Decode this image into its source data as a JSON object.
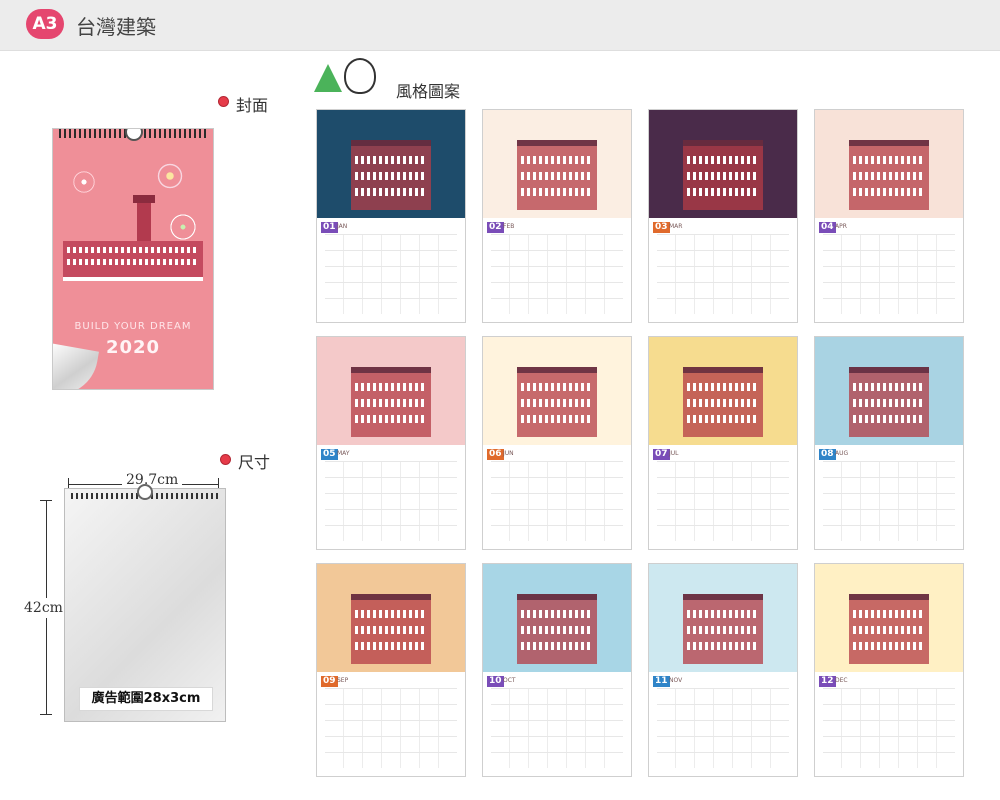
{
  "header": {
    "badge": "A3",
    "title": "台灣建築"
  },
  "cover_section": {
    "label": "封面",
    "build_text": "BUILD YOUR DREAM",
    "year": "2020"
  },
  "size_section": {
    "label": "尺寸",
    "width": "29.7cm",
    "height": "42cm",
    "ad_area": "廣告範圍28x3cm"
  },
  "style_section": {
    "label": "風格圖案"
  },
  "months": [
    {
      "num": "01",
      "name": "JAN",
      "accent": "#7a4db8",
      "bg": "#1e4c6b"
    },
    {
      "num": "02",
      "name": "FEB",
      "accent": "#7a4db8",
      "bg": "#fbeee3"
    },
    {
      "num": "03",
      "name": "MAR",
      "accent": "#e06a2c",
      "bg": "#4a2b4a"
    },
    {
      "num": "04",
      "name": "APR",
      "accent": "#7a4db8",
      "bg": "#f8e2d8"
    },
    {
      "num": "05",
      "name": "MAY",
      "accent": "#2f84c8",
      "bg": "#f4c9c9"
    },
    {
      "num": "06",
      "name": "JUN",
      "accent": "#e06a2c",
      "bg": "#fff3dd"
    },
    {
      "num": "07",
      "name": "JUL",
      "accent": "#7a4db8",
      "bg": "#f6dc8f"
    },
    {
      "num": "08",
      "name": "AUG",
      "accent": "#2f84c8",
      "bg": "#a9d3e3"
    },
    {
      "num": "09",
      "name": "SEP",
      "accent": "#e06a2c",
      "bg": "#f2c898"
    },
    {
      "num": "10",
      "name": "OCT",
      "accent": "#7a4db8",
      "bg": "#a8d6e6"
    },
    {
      "num": "11",
      "name": "NOV",
      "accent": "#2f84c8",
      "bg": "#cde8f0"
    },
    {
      "num": "12",
      "name": "DEC",
      "accent": "#7a4db8",
      "bg": "#fff0c4"
    }
  ]
}
